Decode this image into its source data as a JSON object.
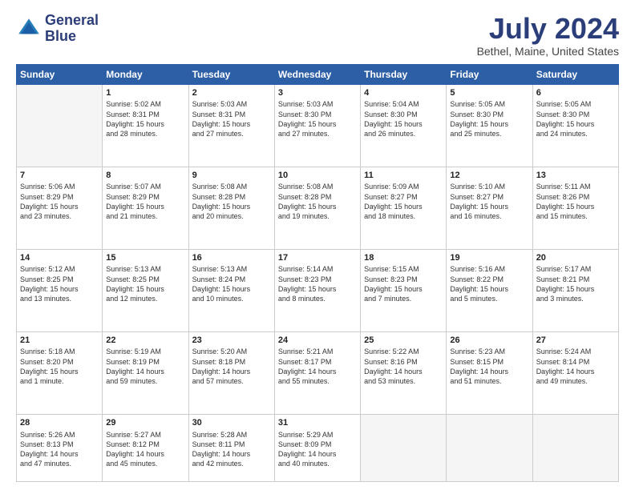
{
  "header": {
    "logo_line1": "General",
    "logo_line2": "Blue",
    "month": "July 2024",
    "location": "Bethel, Maine, United States"
  },
  "days_of_week": [
    "Sunday",
    "Monday",
    "Tuesday",
    "Wednesday",
    "Thursday",
    "Friday",
    "Saturday"
  ],
  "weeks": [
    [
      {
        "day": "",
        "info": ""
      },
      {
        "day": "1",
        "info": "Sunrise: 5:02 AM\nSunset: 8:31 PM\nDaylight: 15 hours\nand 28 minutes."
      },
      {
        "day": "2",
        "info": "Sunrise: 5:03 AM\nSunset: 8:31 PM\nDaylight: 15 hours\nand 27 minutes."
      },
      {
        "day": "3",
        "info": "Sunrise: 5:03 AM\nSunset: 8:30 PM\nDaylight: 15 hours\nand 27 minutes."
      },
      {
        "day": "4",
        "info": "Sunrise: 5:04 AM\nSunset: 8:30 PM\nDaylight: 15 hours\nand 26 minutes."
      },
      {
        "day": "5",
        "info": "Sunrise: 5:05 AM\nSunset: 8:30 PM\nDaylight: 15 hours\nand 25 minutes."
      },
      {
        "day": "6",
        "info": "Sunrise: 5:05 AM\nSunset: 8:30 PM\nDaylight: 15 hours\nand 24 minutes."
      }
    ],
    [
      {
        "day": "7",
        "info": "Sunrise: 5:06 AM\nSunset: 8:29 PM\nDaylight: 15 hours\nand 23 minutes."
      },
      {
        "day": "8",
        "info": "Sunrise: 5:07 AM\nSunset: 8:29 PM\nDaylight: 15 hours\nand 21 minutes."
      },
      {
        "day": "9",
        "info": "Sunrise: 5:08 AM\nSunset: 8:28 PM\nDaylight: 15 hours\nand 20 minutes."
      },
      {
        "day": "10",
        "info": "Sunrise: 5:08 AM\nSunset: 8:28 PM\nDaylight: 15 hours\nand 19 minutes."
      },
      {
        "day": "11",
        "info": "Sunrise: 5:09 AM\nSunset: 8:27 PM\nDaylight: 15 hours\nand 18 minutes."
      },
      {
        "day": "12",
        "info": "Sunrise: 5:10 AM\nSunset: 8:27 PM\nDaylight: 15 hours\nand 16 minutes."
      },
      {
        "day": "13",
        "info": "Sunrise: 5:11 AM\nSunset: 8:26 PM\nDaylight: 15 hours\nand 15 minutes."
      }
    ],
    [
      {
        "day": "14",
        "info": "Sunrise: 5:12 AM\nSunset: 8:25 PM\nDaylight: 15 hours\nand 13 minutes."
      },
      {
        "day": "15",
        "info": "Sunrise: 5:13 AM\nSunset: 8:25 PM\nDaylight: 15 hours\nand 12 minutes."
      },
      {
        "day": "16",
        "info": "Sunrise: 5:13 AM\nSunset: 8:24 PM\nDaylight: 15 hours\nand 10 minutes."
      },
      {
        "day": "17",
        "info": "Sunrise: 5:14 AM\nSunset: 8:23 PM\nDaylight: 15 hours\nand 8 minutes."
      },
      {
        "day": "18",
        "info": "Sunrise: 5:15 AM\nSunset: 8:23 PM\nDaylight: 15 hours\nand 7 minutes."
      },
      {
        "day": "19",
        "info": "Sunrise: 5:16 AM\nSunset: 8:22 PM\nDaylight: 15 hours\nand 5 minutes."
      },
      {
        "day": "20",
        "info": "Sunrise: 5:17 AM\nSunset: 8:21 PM\nDaylight: 15 hours\nand 3 minutes."
      }
    ],
    [
      {
        "day": "21",
        "info": "Sunrise: 5:18 AM\nSunset: 8:20 PM\nDaylight: 15 hours\nand 1 minute."
      },
      {
        "day": "22",
        "info": "Sunrise: 5:19 AM\nSunset: 8:19 PM\nDaylight: 14 hours\nand 59 minutes."
      },
      {
        "day": "23",
        "info": "Sunrise: 5:20 AM\nSunset: 8:18 PM\nDaylight: 14 hours\nand 57 minutes."
      },
      {
        "day": "24",
        "info": "Sunrise: 5:21 AM\nSunset: 8:17 PM\nDaylight: 14 hours\nand 55 minutes."
      },
      {
        "day": "25",
        "info": "Sunrise: 5:22 AM\nSunset: 8:16 PM\nDaylight: 14 hours\nand 53 minutes."
      },
      {
        "day": "26",
        "info": "Sunrise: 5:23 AM\nSunset: 8:15 PM\nDaylight: 14 hours\nand 51 minutes."
      },
      {
        "day": "27",
        "info": "Sunrise: 5:24 AM\nSunset: 8:14 PM\nDaylight: 14 hours\nand 49 minutes."
      }
    ],
    [
      {
        "day": "28",
        "info": "Sunrise: 5:26 AM\nSunset: 8:13 PM\nDaylight: 14 hours\nand 47 minutes."
      },
      {
        "day": "29",
        "info": "Sunrise: 5:27 AM\nSunset: 8:12 PM\nDaylight: 14 hours\nand 45 minutes."
      },
      {
        "day": "30",
        "info": "Sunrise: 5:28 AM\nSunset: 8:11 PM\nDaylight: 14 hours\nand 42 minutes."
      },
      {
        "day": "31",
        "info": "Sunrise: 5:29 AM\nSunset: 8:09 PM\nDaylight: 14 hours\nand 40 minutes."
      },
      {
        "day": "",
        "info": ""
      },
      {
        "day": "",
        "info": ""
      },
      {
        "day": "",
        "info": ""
      }
    ]
  ]
}
